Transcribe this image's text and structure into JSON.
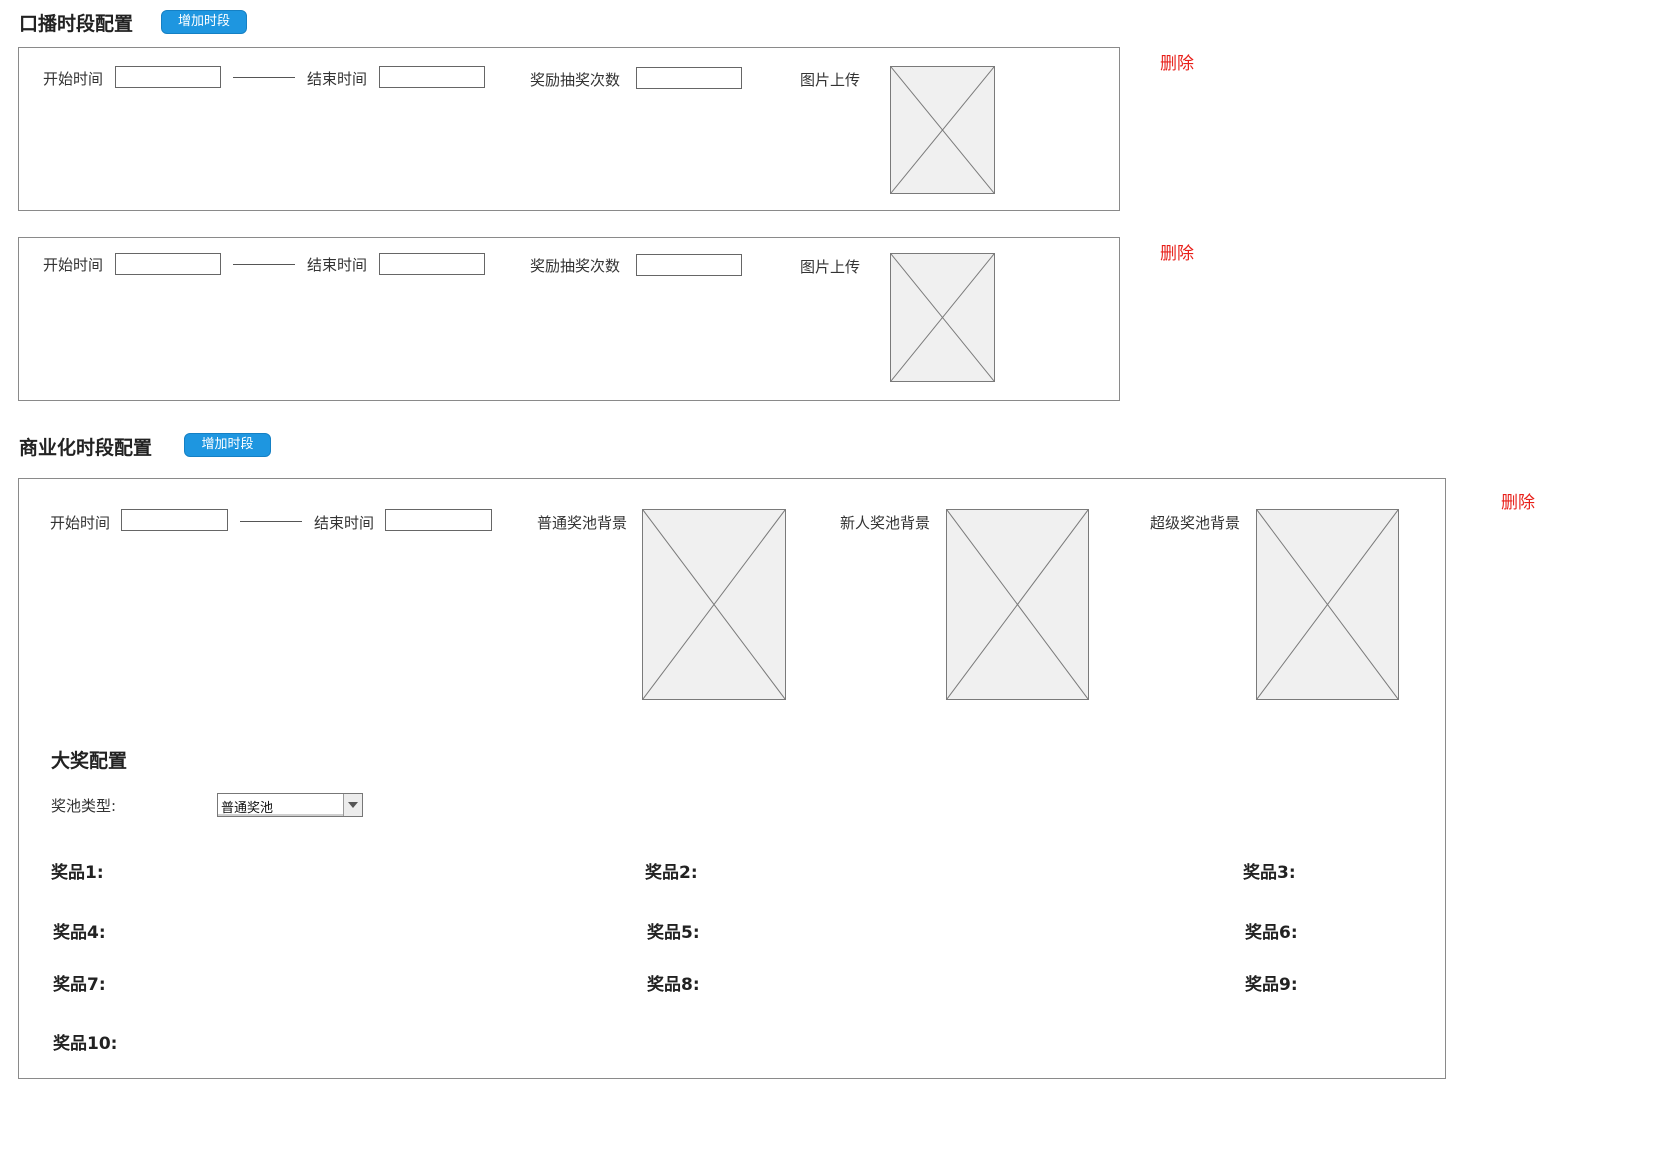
{
  "oral": {
    "title": "口播时段配置",
    "add_label": "增加时段",
    "slots": [
      {
        "start_label": "开始时间",
        "start_value": "",
        "end_label": "结束时间",
        "end_value": "",
        "count_label": "奖励抽奖次数",
        "count_value": "",
        "image_label": "图片上传",
        "delete_label": "删除"
      },
      {
        "start_label": "开始时间",
        "start_value": "",
        "end_label": "结束时间",
        "end_value": "",
        "count_label": "奖励抽奖次数",
        "count_value": "",
        "image_label": "图片上传",
        "delete_label": "删除"
      }
    ]
  },
  "commercial": {
    "title": "商业化时段配置",
    "add_label": "增加时段",
    "slot": {
      "start_label": "开始时间",
      "start_value": "",
      "end_label": "结束时间",
      "end_value": "",
      "normal_bg_label": "普通奖池背景",
      "newbie_bg_label": "新人奖池背景",
      "super_bg_label": "超级奖池背景",
      "delete_label": "删除",
      "grand_prize": {
        "title": "大奖配置",
        "pool_type_label": "奖池类型:",
        "pool_type_value": "普通奖池",
        "prizes": [
          "奖品1:",
          "奖品2:",
          "奖品3:",
          "奖品4:",
          "奖品5:",
          "奖品6:",
          "奖品7:",
          "奖品8:",
          "奖品9:",
          "奖品10:"
        ]
      }
    }
  },
  "icons": {
    "image_placeholder": "image-placeholder-icon",
    "dropdown": "chevron-down-icon"
  },
  "colors": {
    "accent": "#1e96e0",
    "delete": "#e8201a",
    "border": "#8a8a8a"
  }
}
